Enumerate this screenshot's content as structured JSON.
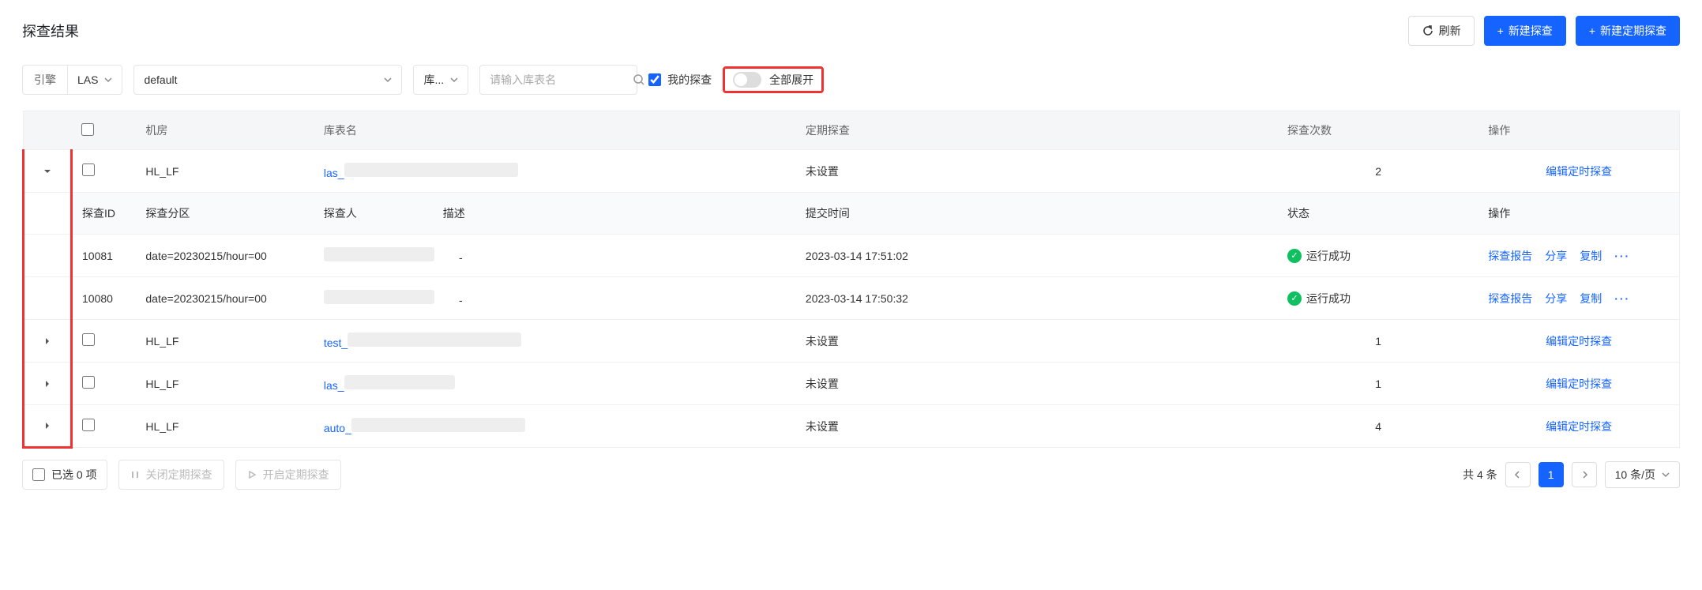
{
  "header": {
    "title": "探查结果",
    "refresh": "刷新",
    "new_probe": "新建探查",
    "new_scheduled": "新建定期探查"
  },
  "filters": {
    "engine_label": "引擎",
    "engine_value": "LAS",
    "default_value": "default",
    "table_type_label": "库...",
    "search_placeholder": "请输入库表名",
    "my_probes": "我的探查",
    "expand_all": "全部展开"
  },
  "table_headers": {
    "room": "机房",
    "table_name": "库表名",
    "schedule": "定期探查",
    "count": "探查次数",
    "ops": "操作"
  },
  "sub_headers": {
    "probe_id": "探查ID",
    "partition": "探查分区",
    "probe_user": "探查人",
    "desc": "描述",
    "submit_time": "提交时间",
    "status": "状态",
    "ops": "操作"
  },
  "rows": [
    {
      "room": "HL_LF",
      "table_prefix": "las_",
      "schedule": "未设置",
      "count": "2",
      "edit": "编辑定时探查",
      "expanded": true
    },
    {
      "room": "HL_LF",
      "table_prefix": "test_",
      "schedule": "未设置",
      "count": "1",
      "edit": "编辑定时探查",
      "expanded": false
    },
    {
      "room": "HL_LF",
      "table_prefix": "las_",
      "schedule": "未设置",
      "count": "1",
      "edit": "编辑定时探查",
      "expanded": false
    },
    {
      "room": "HL_LF",
      "table_prefix": "auto_",
      "schedule": "未设置",
      "count": "4",
      "edit": "编辑定时探查",
      "expanded": false
    }
  ],
  "sub_rows": [
    {
      "id": "10081",
      "partition": "date=20230215/hour=00",
      "desc": "-",
      "time": "2023-03-14 17:51:02",
      "status": "运行成功"
    },
    {
      "id": "10080",
      "partition": "date=20230215/hour=00",
      "desc": "-",
      "time": "2023-03-14 17:50:32",
      "status": "运行成功"
    }
  ],
  "row_actions": {
    "report": "探查报告",
    "share": "分享",
    "copy": "复制"
  },
  "footer": {
    "selected": "已选 0 项",
    "close_schedule": "关闭定期探查",
    "open_schedule": "开启定期探查",
    "total_prefix": "共 ",
    "total_count": "4",
    "total_suffix": " 条",
    "page": "1",
    "page_size": "10 条/页"
  }
}
